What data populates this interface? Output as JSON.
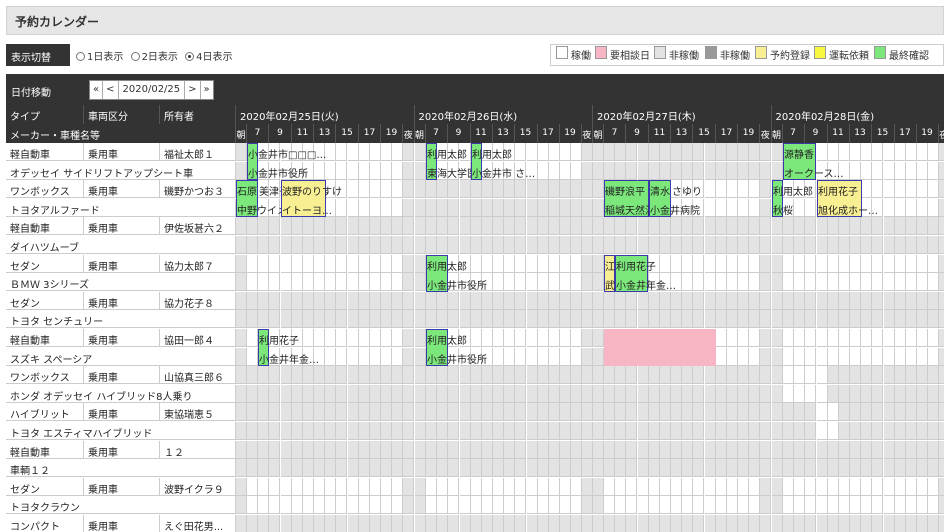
{
  "page_title": "予約カレンダー",
  "display_toggle": {
    "label": "表示切替",
    "options": [
      "1日表示",
      "2日表示",
      "4日表示"
    ],
    "selected": "4日表示"
  },
  "legend": [
    {
      "label": "稼働",
      "color": "#ffffff"
    },
    {
      "label": "要相談日",
      "color": "#f8b6c4"
    },
    {
      "label": "非稼働",
      "color": "#e3e3e3"
    },
    {
      "label": "非稼働",
      "color": "#999999"
    },
    {
      "label": "予約登録",
      "color": "#f8ee92"
    },
    {
      "label": "運転依頼",
      "color": "#f8f840"
    },
    {
      "label": "最終確認",
      "color": "#7ce87c"
    }
  ],
  "date_nav": {
    "label": "日付移動",
    "first": "«",
    "prev": "<",
    "date": "2020/02/25",
    "next": ">",
    "last": "»"
  },
  "headers": {
    "type": "タイプ",
    "vehicle_class": "車両区分",
    "owner": "所有者",
    "maker_model": "メーカー・車種名等"
  },
  "days": [
    "2020年02月25日(火)",
    "2020年02月26日(水)",
    "2020年02月27日(木)",
    "2020年02月28日(金)"
  ],
  "hour_labels": [
    "朝",
    "7",
    "9",
    "11",
    "13",
    "15",
    "17",
    "19",
    "夜"
  ],
  "vehicles": [
    {
      "type": "軽自動車",
      "class": "乗用車",
      "owner": "福祉太郎１",
      "model": "オデッセイ サイドリフトアップシート車"
    },
    {
      "type": "ワンボックス",
      "class": "乗用車",
      "owner": "磯野かつお３",
      "model": "トヨタアルファード"
    },
    {
      "type": "軽自動車",
      "class": "乗用車",
      "owner": "伊佐坂甚六２",
      "model": "ダイハツムーブ"
    },
    {
      "type": "セダン",
      "class": "乗用車",
      "owner": "協力太郎７",
      "model": "ＢＭＷ 3シリーズ"
    },
    {
      "type": "セダン",
      "class": "乗用車",
      "owner": "協力花子８",
      "model": "トヨタ センチュリー"
    },
    {
      "type": "軽自動車",
      "class": "乗用車",
      "owner": "協田一郎４",
      "model": "スズキ スペーシア"
    },
    {
      "type": "ワンボックス",
      "class": "乗用車",
      "owner": "山協真三郎６",
      "model": "ホンダ オデッセイ ハイブリッド8人乗り"
    },
    {
      "type": "ハイブリット",
      "class": "乗用車",
      "owner": "東協瑞恵５",
      "model": "トヨタ エスティマハイブリッド"
    },
    {
      "type": "軽自動車",
      "class": "乗用車",
      "owner": "１２",
      "model": "車輌１２"
    },
    {
      "type": "セダン",
      "class": "乗用車",
      "owner": "波野イクラ９",
      "model": "トヨタクラウン"
    },
    {
      "type": "コンパクト",
      "class": "乗用車",
      "owner": "えぐ田花男...",
      "model": ""
    }
  ],
  "events": [
    {
      "line1": "小金井市□□□…",
      "line2": "小金井市役所",
      "color": "green"
    },
    {
      "line1": "利用太郎",
      "line2": "東海大学医…",
      "color": "green"
    },
    {
      "line1": "利用太郎",
      "line2": "小金井市 さ…",
      "color": "green"
    },
    {
      "line1": "源静香",
      "line2": "オークース…",
      "color": "green"
    },
    {
      "line1": "石原",
      "line2": "中野ウイメ…",
      "color": "green"
    },
    {
      "line1": "美津子",
      "line2": "",
      "color": "none"
    },
    {
      "line1": "波野のりすけ",
      "line2": "イトーヨ…",
      "color": "yellow"
    },
    {
      "line1": "磯野浪平",
      "line2": "稲城天然温泉",
      "color": "green"
    },
    {
      "line1": "清水",
      "line2": "小金井病院",
      "color": "green"
    },
    {
      "line1": "さゆり",
      "line2": "",
      "color": "none"
    },
    {
      "line1": "利用太郎",
      "line2": "秋桜",
      "color": "green"
    },
    {
      "line1": "利用花子",
      "line2": "旭化成ホー…",
      "color": "yellow"
    },
    {
      "line1": "利用太郎",
      "line2": "小金井市役所",
      "color": "green"
    },
    {
      "line1": "江戸川",
      "line2": "武蔵野",
      "color": "yellow"
    },
    {
      "line1": "利用花子",
      "line2": "小金井年金…",
      "color": "green"
    },
    {
      "line1": "利用花子",
      "line2": "小金井年金…",
      "color": "green"
    },
    {
      "line1": "利用太郎",
      "line2": "小金井市役所",
      "color": "green"
    },
    {
      "line1": "",
      "line2": "",
      "color": "pink"
    }
  ]
}
